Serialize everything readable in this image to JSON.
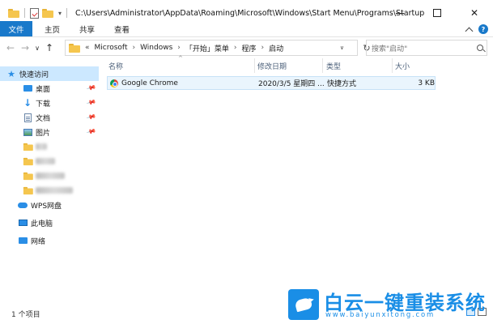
{
  "window": {
    "title_path": "C:\\Users\\Administrator\\AppData\\Roaming\\Microsoft\\Windows\\Start Menu\\Programs\\Startup",
    "controls": {
      "minimize": "",
      "maximize": "",
      "close": "✕"
    }
  },
  "ribbon": {
    "tabs": [
      "文件",
      "主页",
      "共享",
      "查看"
    ],
    "help": "?"
  },
  "address": {
    "back": "←",
    "forward": "→",
    "recent": "∨",
    "up": "↑",
    "overflow": "«",
    "crumbs": [
      "Microsoft",
      "Windows",
      "「开始」菜单",
      "程序",
      "启动"
    ],
    "separator": "›",
    "refresh": "↻",
    "search_placeholder": "搜索\"启动\""
  },
  "sidebar": {
    "quick_access": "快速访问",
    "pinned": [
      {
        "label": "桌面",
        "icon": "desktop-icon"
      },
      {
        "label": "下载",
        "icon": "download-icon"
      },
      {
        "label": "文档",
        "icon": "documents-icon"
      },
      {
        "label": "图片",
        "icon": "pictures-icon"
      }
    ],
    "wps": "WPS网盘",
    "this_pc": "此电脑",
    "network": "网络"
  },
  "columns": {
    "name": "名称",
    "modified": "修改日期",
    "type": "类型",
    "size": "大小",
    "sort_indicator": "^"
  },
  "files": [
    {
      "name": "Google Chrome",
      "modified": "2020/3/5 星期四 ...",
      "type": "快捷方式",
      "size": "3 KB",
      "icon": "chrome-icon"
    }
  ],
  "status": {
    "item_count": "1 个项目"
  },
  "watermark": {
    "title": "白云一键重装系统",
    "url": "www.baiyunxitong.com"
  }
}
